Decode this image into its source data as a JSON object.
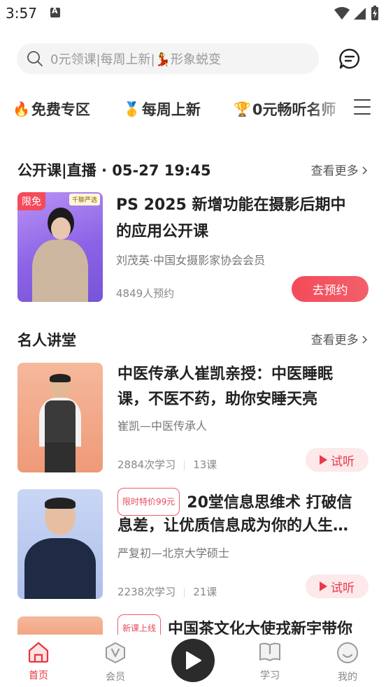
{
  "status_bar": {
    "time": "3:57"
  },
  "search": {
    "placeholder": "0元领课|每周上新|💃形象蜕变"
  },
  "categories": [
    {
      "emoji": "🔥",
      "label": "免费专区"
    },
    {
      "emoji": "🥇",
      "label": "每周上新"
    },
    {
      "emoji": "🏆",
      "label": "0元畅听名师"
    }
  ],
  "live_section": {
    "title": "公开课|直播 · 05-27 19:45",
    "see_more": "查看更多",
    "card": {
      "badge": "限免",
      "brand_tag": "千聊严选",
      "title_line1": "PS 2025 新增功能在摄影后期中",
      "title_line2": "的应用公开课",
      "speaker": "刘茂英·中国女摄影家协会会员",
      "reservations": "4849人预约",
      "button": "去预约"
    }
  },
  "celebrity_section": {
    "title": "名人讲堂",
    "see_more": "查看更多",
    "courses": [
      {
        "tag": "",
        "title_line1": "中医传承人崔凯亲授：中医睡眠",
        "title_line2": "课，不医不药，助你安睡天亮",
        "speaker": "崔凯—中医传承人",
        "learners": "2884次学习",
        "lessons": "13课",
        "button": "试听"
      },
      {
        "tag": "限时特价99元",
        "title_line1": "20堂信息思维术 打破信",
        "title_line2": "息差，让优质信息成为你的人生…",
        "speaker": "严复初—北京大学硕士",
        "learners": "2238次学习",
        "lessons": "21课",
        "button": "试听"
      },
      {
        "tag": "新课上线",
        "title_line1": "中国茶文化大使戎新宇带你"
      }
    ]
  },
  "bottom_nav": {
    "items": [
      {
        "label": "首页",
        "icon": "home-icon",
        "active": true
      },
      {
        "label": "会员",
        "icon": "vip-icon",
        "active": false
      },
      {
        "label": "学习",
        "icon": "book-icon",
        "active": false
      },
      {
        "label": "我的",
        "icon": "profile-icon",
        "active": false
      }
    ]
  },
  "colors": {
    "accent": "#e8343e",
    "tag_red": "#f05a68",
    "try_bg": "#fde8ea"
  }
}
